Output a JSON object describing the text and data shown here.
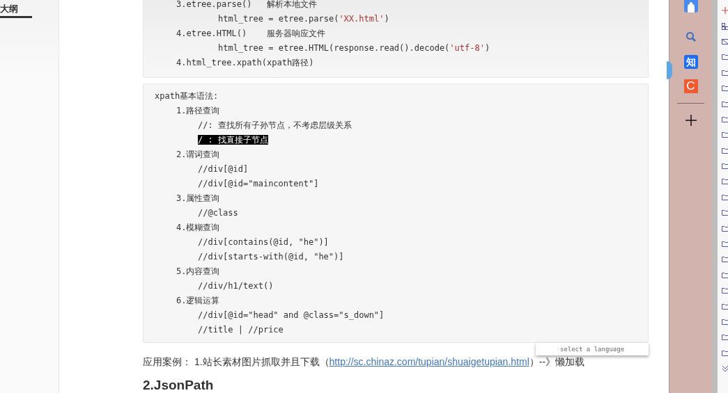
{
  "outline_tab": {
    "label": "大纲",
    "selected": true
  },
  "code_blocks": [
    {
      "lines": [
        {
          "segments": [
            {
              "kind": "plain",
              "text": "3.etree.parse()   解析本地文件"
            }
          ],
          "children": [
            {
              "segments": [
                {
                  "kind": "plain",
                  "text": "html_tree = etree.parse("
                },
                {
                  "kind": "string",
                  "text": "'XX.html'"
                },
                {
                  "kind": "plain",
                  "text": ")"
                }
              ]
            }
          ]
        },
        {
          "segments": [
            {
              "kind": "plain",
              "text": "4.etree.HTML()    服务器响应文件"
            }
          ],
          "children": [
            {
              "segments": [
                {
                  "kind": "plain",
                  "text": "html_tree = etree.HTML(response.read().decode("
                },
                {
                  "kind": "string",
                  "text": "'utf-8'"
                },
                {
                  "kind": "plain",
                  "text": ")"
                }
              ]
            }
          ]
        },
        {
          "segments": [
            {
              "kind": "plain",
              "text": "4.html_tree.xpath(xpath路径)"
            }
          ]
        }
      ]
    },
    {
      "lines": [
        {
          "segments": [
            {
              "kind": "plain",
              "text": "xpath基本语法:"
            }
          ],
          "children": [
            {
              "segments": [
                {
                  "kind": "plain",
                  "text": "1.路径查询"
                }
              ],
              "children": [
                {
                  "segments": [
                    {
                      "kind": "plain",
                      "text": "//: 查找所有子孙节点，不考虑层级关系"
                    }
                  ]
                },
                {
                  "segments": [
                    {
                      "kind": "selected",
                      "text": "/ : 找直接子节点"
                    }
                  ]
                }
              ]
            },
            {
              "segments": [
                {
                  "kind": "plain",
                  "text": "2.谓词查询"
                }
              ],
              "children": [
                {
                  "segments": [
                    {
                      "kind": "plain",
                      "text": "//div[@id]"
                    }
                  ]
                },
                {
                  "segments": [
                    {
                      "kind": "plain",
                      "text": "//div[@id=\"maincontent\"]"
                    }
                  ]
                }
              ]
            },
            {
              "segments": [
                {
                  "kind": "plain",
                  "text": "3.属性查询"
                }
              ],
              "children": [
                {
                  "segments": [
                    {
                      "kind": "plain",
                      "text": "//@class"
                    }
                  ]
                }
              ]
            },
            {
              "segments": [
                {
                  "kind": "plain",
                  "text": "4.模糊查询"
                }
              ],
              "children": [
                {
                  "segments": [
                    {
                      "kind": "plain",
                      "text": "//div[contains(@id, \"he\")]"
                    }
                  ]
                },
                {
                  "segments": [
                    {
                      "kind": "plain",
                      "text": "//div[starts-with(@id, \"he\")]"
                    }
                  ]
                }
              ]
            },
            {
              "segments": [
                {
                  "kind": "plain",
                  "text": "5.内容查询"
                }
              ],
              "children": [
                {
                  "segments": [
                    {
                      "kind": "plain",
                      "text": "//div/h1/text()"
                    }
                  ]
                }
              ]
            },
            {
              "segments": [
                {
                  "kind": "plain",
                  "text": "6.逻辑运算"
                }
              ],
              "children": [
                {
                  "segments": [
                    {
                      "kind": "plain",
                      "text": "//div[@id=\"head\" and @class=\"s_down\"]"
                    }
                  ]
                },
                {
                  "segments": [
                    {
                      "kind": "plain",
                      "text": "//title | //price"
                    }
                  ]
                }
              ]
            }
          ]
        }
      ]
    }
  ],
  "example": {
    "label": "应用案例：",
    "text": "1.站长素材图片抓取并且下载（",
    "link": "http://sc.chinaz.com/tupian/shuaigetupian.html",
    "after": "）--》懒加载"
  },
  "language_popup": {
    "text": "select a language"
  },
  "heading": "2.JsonPath",
  "side_apps": [
    {
      "kind": "app"
    },
    {
      "kind": "search"
    },
    {
      "kind": "zhi",
      "text": "知"
    },
    {
      "kind": "c",
      "text": "C"
    },
    {
      "kind": "divider"
    },
    {
      "kind": "add"
    }
  ],
  "folder_list": [
    {
      "kind": "add"
    },
    {
      "kind": "grid"
    },
    {
      "kind": "mail"
    },
    {
      "kind": "folder"
    },
    {
      "kind": "folder"
    },
    {
      "kind": "folder"
    },
    {
      "kind": "folder"
    },
    {
      "kind": "folder"
    },
    {
      "kind": "folder"
    },
    {
      "kind": "folder"
    },
    {
      "kind": "folder"
    },
    {
      "kind": "folder"
    },
    {
      "kind": "folder"
    },
    {
      "kind": "folder"
    },
    {
      "kind": "folder"
    },
    {
      "kind": "folder"
    },
    {
      "kind": "folder"
    },
    {
      "kind": "folder"
    },
    {
      "kind": "folder"
    },
    {
      "kind": "folder"
    },
    {
      "kind": "folder"
    },
    {
      "kind": "folder"
    },
    {
      "kind": "folder"
    },
    {
      "kind": "more"
    }
  ]
}
